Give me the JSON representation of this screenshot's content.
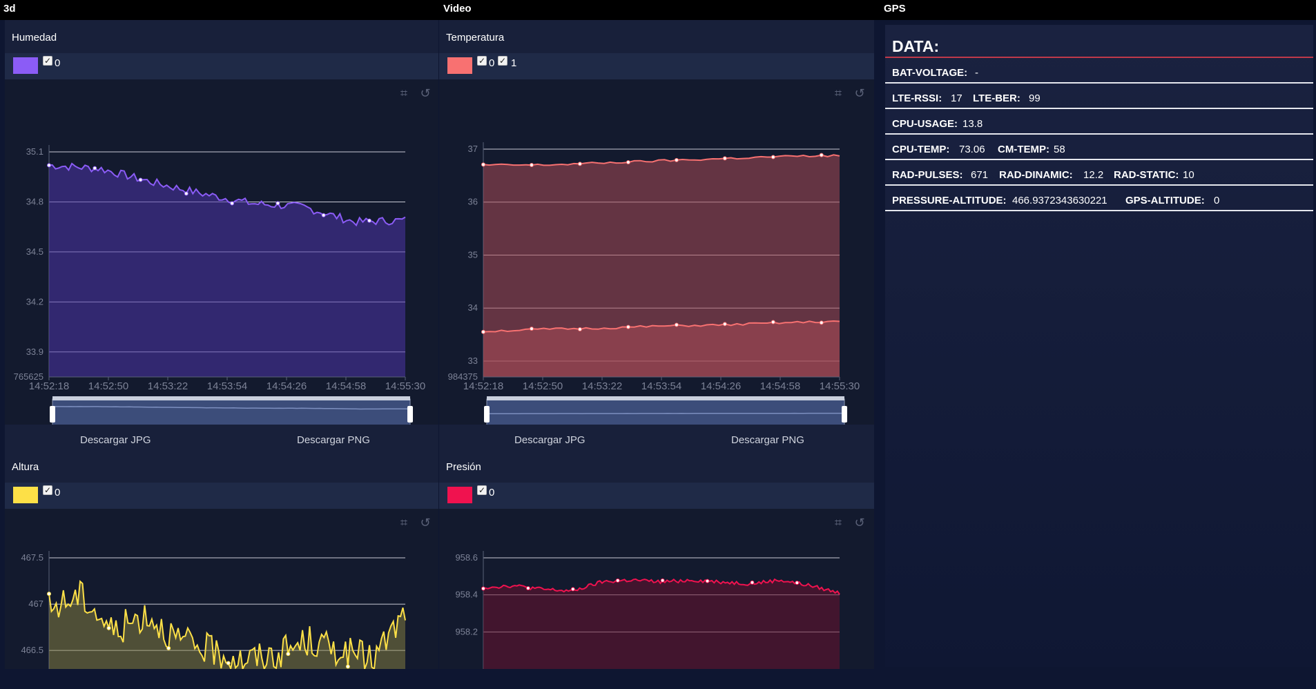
{
  "tabs": [
    "3d",
    "Video",
    "GPS"
  ],
  "charts": [
    {
      "title": "Humedad",
      "color": "#8b5cf6",
      "checkboxes": [
        "0"
      ],
      "y_ticks": [
        "35.1",
        "34.8",
        "34.5",
        "34.2",
        "33.9"
      ],
      "y_min_label": "765625",
      "x_ticks": [
        "14:52:18",
        "14:52:50",
        "14:53:22",
        "14:53:54",
        "14:54:26",
        "14:54:58",
        "14:55:30"
      ],
      "downloads": [
        "Descargar JPG",
        "Descargar PNG"
      ]
    },
    {
      "title": "Temperatura",
      "color": "#f87171",
      "checkboxes": [
        "0",
        "1"
      ],
      "y_ticks": [
        "37",
        "36",
        "35",
        "34",
        "33"
      ],
      "y_min_label": "984375",
      "x_ticks": [
        "14:52:18",
        "14:52:50",
        "14:53:22",
        "14:53:54",
        "14:54:26",
        "14:54:58",
        "14:55:30"
      ],
      "downloads": [
        "Descargar JPG",
        "Descargar PNG"
      ]
    },
    {
      "title": "Altura",
      "color": "#fde047",
      "checkboxes": [
        "0"
      ],
      "y_ticks": [
        "467.5",
        "467",
        "466.5"
      ]
    },
    {
      "title": "Presión",
      "color": "#f0124f",
      "checkboxes": [
        "0"
      ],
      "y_ticks": [
        "958.6",
        "958.4",
        "958.2"
      ]
    }
  ],
  "chart_data": [
    {
      "type": "area",
      "title": "Humedad",
      "ylim": [
        33.75,
        35.1
      ],
      "x": [
        "14:52:18",
        "14:52:50",
        "14:53:22",
        "14:53:54",
        "14:54:26",
        "14:54:58",
        "14:55:30"
      ],
      "series": [
        {
          "name": "0",
          "values": [
            35.02,
            35.0,
            34.92,
            34.85,
            34.79,
            34.77,
            34.68,
            34.69
          ]
        }
      ]
    },
    {
      "type": "area",
      "title": "Temperatura",
      "ylim": [
        32.7,
        37.0
      ],
      "x": [
        "14:52:18",
        "14:52:50",
        "14:53:22",
        "14:53:54",
        "14:54:26",
        "14:54:58",
        "14:55:30"
      ],
      "series": [
        {
          "name": "0",
          "values": [
            36.7,
            36.7,
            36.74,
            36.78,
            36.82,
            36.86,
            36.88
          ]
        },
        {
          "name": "1",
          "values": [
            33.56,
            33.6,
            33.62,
            33.66,
            33.68,
            33.72,
            33.75
          ]
        }
      ]
    },
    {
      "type": "area",
      "title": "Altura",
      "ylim": [
        466.3,
        467.5
      ],
      "series": [
        {
          "name": "0",
          "values": [
            466.95,
            467.1,
            466.7,
            466.9,
            466.6,
            466.5,
            466.4,
            466.45,
            466.6,
            466.5,
            466.4,
            466.9
          ]
        }
      ]
    },
    {
      "type": "area",
      "title": "Presión",
      "ylim": [
        958.0,
        958.6
      ],
      "series": [
        {
          "name": "0",
          "values": [
            958.44,
            958.45,
            958.43,
            958.42,
            958.47,
            958.48,
            958.47,
            958.48,
            958.47,
            958.46,
            958.48,
            958.45,
            958.41
          ]
        }
      ]
    }
  ],
  "data_panel": {
    "heading": "DATA:",
    "rows": [
      {
        "k1": "BAT-VOLTAGE:",
        "v1": "-"
      },
      {
        "k1": "LTE-RSSI:",
        "v1": "17",
        "k2": "LTE-BER:",
        "v2": "99"
      },
      {
        "k1": "CPU-USAGE:",
        "v1": "13.8"
      },
      {
        "k1": "CPU-TEMP:",
        "v1": "73.06",
        "k2": "CM-TEMP:",
        "v2": "58"
      },
      {
        "k1": "RAD-PULSES:",
        "v1": "671",
        "k2": "RAD-DINAMIC:",
        "v2": "12.2",
        "k3": "RAD-STATIC:",
        "v3": "10"
      },
      {
        "k1": "PRESSURE-ALTITUDE:",
        "v1": "466.9372343630221",
        "k2": "GPS-ALTITUDE:",
        "v2": "0"
      }
    ]
  }
}
